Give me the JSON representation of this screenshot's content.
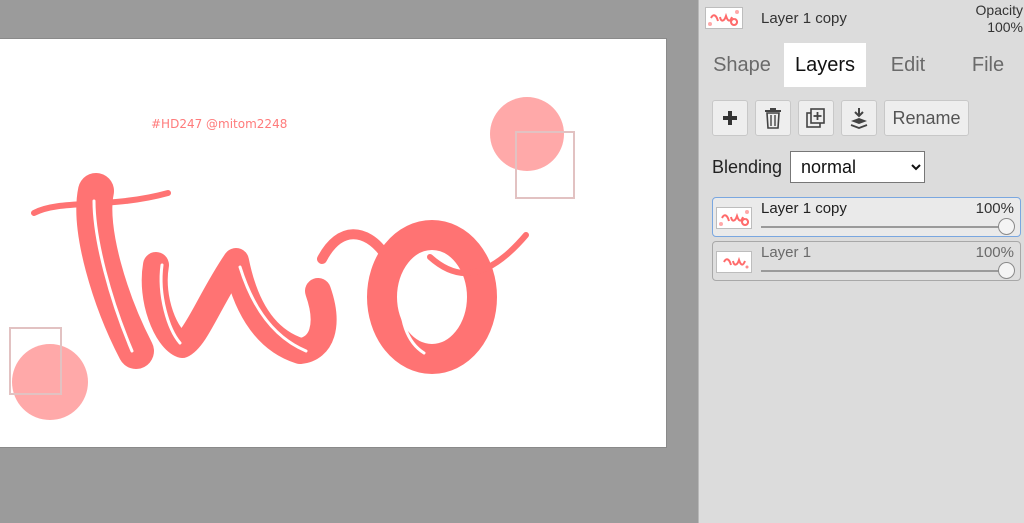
{
  "canvas": {
    "watermark_text": "#HD247 @mitom2248",
    "artwork_text": "two",
    "colors": {
      "lettering": "#ff7373",
      "circle": "#ffa9a9",
      "frame": "#e2c2c2",
      "background": "#ffffff",
      "workspace": "#9b9b9b"
    }
  },
  "header": {
    "layer_name": "Layer 1 copy",
    "opacity_label": "Opacity",
    "opacity_value": "100%"
  },
  "tabs": [
    {
      "label": "Shape",
      "active": false
    },
    {
      "label": "Layers",
      "active": true
    },
    {
      "label": "Edit",
      "active": false
    },
    {
      "label": "File",
      "active": false
    }
  ],
  "toolbar": {
    "add_icon": "plus-icon",
    "delete_icon": "trash-icon",
    "duplicate_icon": "duplicate-icon",
    "merge_icon": "merge-down-icon",
    "rename_label": "Rename"
  },
  "blending": {
    "label": "Blending",
    "selected": "normal",
    "options": [
      "normal"
    ]
  },
  "layers": [
    {
      "name": "Layer 1 copy",
      "opacity": "100%",
      "opacity_fraction": 1.0,
      "selected": true
    },
    {
      "name": "Layer 1",
      "opacity": "100%",
      "opacity_fraction": 1.0,
      "selected": false
    }
  ]
}
